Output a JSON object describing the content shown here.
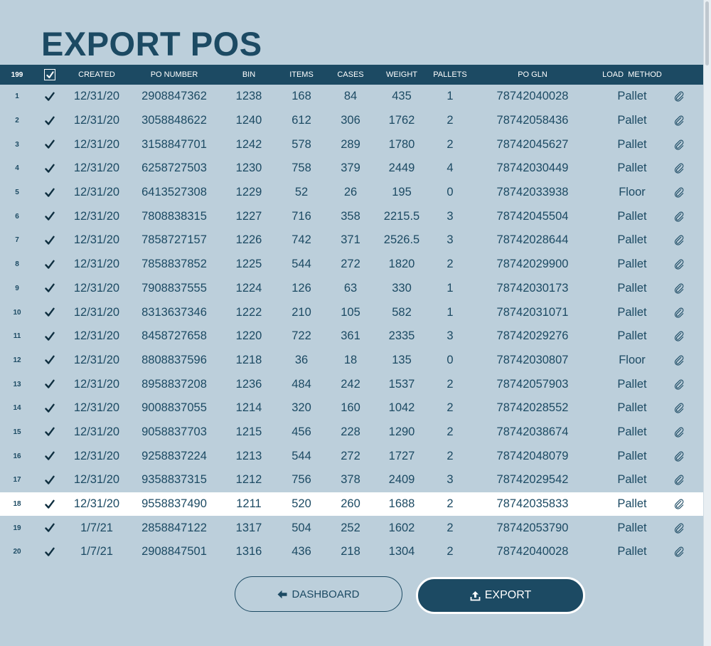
{
  "page": {
    "title": "EXPORT POS"
  },
  "table": {
    "headers": {
      "count": "199",
      "created": "CREATED",
      "po_number": "PO NUMBER",
      "bin": "BIN",
      "items": "ITEMS",
      "cases": "CASES",
      "weight": "WEIGHT",
      "pallets": "PALLETS",
      "po_gln": "PO GLN",
      "load_method": "LOAD  METHOD"
    },
    "selected_row": 18,
    "rows": [
      {
        "num": "1",
        "created": "12/31/20",
        "po": "2908847362",
        "bin": "1238",
        "items": "168",
        "cases": "84",
        "weight": "435",
        "pallets": "1",
        "gln": "78742040028",
        "method": "Pallet"
      },
      {
        "num": "2",
        "created": "12/31/20",
        "po": "3058848622",
        "bin": "1240",
        "items": "612",
        "cases": "306",
        "weight": "1762",
        "pallets": "2",
        "gln": "78742058436",
        "method": "Pallet"
      },
      {
        "num": "3",
        "created": "12/31/20",
        "po": "3158847701",
        "bin": "1242",
        "items": "578",
        "cases": "289",
        "weight": "1780",
        "pallets": "2",
        "gln": "78742045627",
        "method": "Pallet"
      },
      {
        "num": "4",
        "created": "12/31/20",
        "po": "6258727503",
        "bin": "1230",
        "items": "758",
        "cases": "379",
        "weight": "2449",
        "pallets": "4",
        "gln": "78742030449",
        "method": "Pallet"
      },
      {
        "num": "5",
        "created": "12/31/20",
        "po": "6413527308",
        "bin": "1229",
        "items": "52",
        "cases": "26",
        "weight": "195",
        "pallets": "0",
        "gln": "78742033938",
        "method": "Floor"
      },
      {
        "num": "6",
        "created": "12/31/20",
        "po": "7808838315",
        "bin": "1227",
        "items": "716",
        "cases": "358",
        "weight": "2215.5",
        "pallets": "3",
        "gln": "78742045504",
        "method": "Pallet"
      },
      {
        "num": "7",
        "created": "12/31/20",
        "po": "7858727157",
        "bin": "1226",
        "items": "742",
        "cases": "371",
        "weight": "2526.5",
        "pallets": "3",
        "gln": "78742028644",
        "method": "Pallet"
      },
      {
        "num": "8",
        "created": "12/31/20",
        "po": "7858837852",
        "bin": "1225",
        "items": "544",
        "cases": "272",
        "weight": "1820",
        "pallets": "2",
        "gln": "78742029900",
        "method": "Pallet"
      },
      {
        "num": "9",
        "created": "12/31/20",
        "po": "7908837555",
        "bin": "1224",
        "items": "126",
        "cases": "63",
        "weight": "330",
        "pallets": "1",
        "gln": "78742030173",
        "method": "Pallet"
      },
      {
        "num": "10",
        "created": "12/31/20",
        "po": "8313637346",
        "bin": "1222",
        "items": "210",
        "cases": "105",
        "weight": "582",
        "pallets": "1",
        "gln": "78742031071",
        "method": "Pallet"
      },
      {
        "num": "11",
        "created": "12/31/20",
        "po": "8458727658",
        "bin": "1220",
        "items": "722",
        "cases": "361",
        "weight": "2335",
        "pallets": "3",
        "gln": "78742029276",
        "method": "Pallet"
      },
      {
        "num": "12",
        "created": "12/31/20",
        "po": "8808837596",
        "bin": "1218",
        "items": "36",
        "cases": "18",
        "weight": "135",
        "pallets": "0",
        "gln": "78742030807",
        "method": "Floor"
      },
      {
        "num": "13",
        "created": "12/31/20",
        "po": "8958837208",
        "bin": "1236",
        "items": "484",
        "cases": "242",
        "weight": "1537",
        "pallets": "2",
        "gln": "78742057903",
        "method": "Pallet"
      },
      {
        "num": "14",
        "created": "12/31/20",
        "po": "9008837055",
        "bin": "1214",
        "items": "320",
        "cases": "160",
        "weight": "1042",
        "pallets": "2",
        "gln": "78742028552",
        "method": "Pallet"
      },
      {
        "num": "15",
        "created": "12/31/20",
        "po": "9058837703",
        "bin": "1215",
        "items": "456",
        "cases": "228",
        "weight": "1290",
        "pallets": "2",
        "gln": "78742038674",
        "method": "Pallet"
      },
      {
        "num": "16",
        "created": "12/31/20",
        "po": "9258837224",
        "bin": "1213",
        "items": "544",
        "cases": "272",
        "weight": "1727",
        "pallets": "2",
        "gln": "78742048079",
        "method": "Pallet"
      },
      {
        "num": "17",
        "created": "12/31/20",
        "po": "9358837315",
        "bin": "1212",
        "items": "756",
        "cases": "378",
        "weight": "2409",
        "pallets": "3",
        "gln": "78742029542",
        "method": "Pallet"
      },
      {
        "num": "18",
        "created": "12/31/20",
        "po": "9558837490",
        "bin": "1211",
        "items": "520",
        "cases": "260",
        "weight": "1688",
        "pallets": "2",
        "gln": "78742035833",
        "method": "Pallet"
      },
      {
        "num": "19",
        "created": "1/7/21",
        "po": "2858847122",
        "bin": "1317",
        "items": "504",
        "cases": "252",
        "weight": "1602",
        "pallets": "2",
        "gln": "78742053790",
        "method": "Pallet"
      },
      {
        "num": "20",
        "created": "1/7/21",
        "po": "2908847501",
        "bin": "1316",
        "items": "436",
        "cases": "218",
        "weight": "1304",
        "pallets": "2",
        "gln": "78742040028",
        "method": "Pallet"
      }
    ]
  },
  "buttons": {
    "dashboard_label": "DASHBOARD",
    "export_label": "EXPORT"
  },
  "icons": {
    "row_check": "checkmark-icon",
    "row_attach": "paperclip-icon",
    "dashboard": "arrow-left-icon",
    "export": "upload-icon"
  },
  "colors": {
    "background": "#bccfdb",
    "primary": "#1c4a63",
    "selected_row": "#ffffff"
  }
}
